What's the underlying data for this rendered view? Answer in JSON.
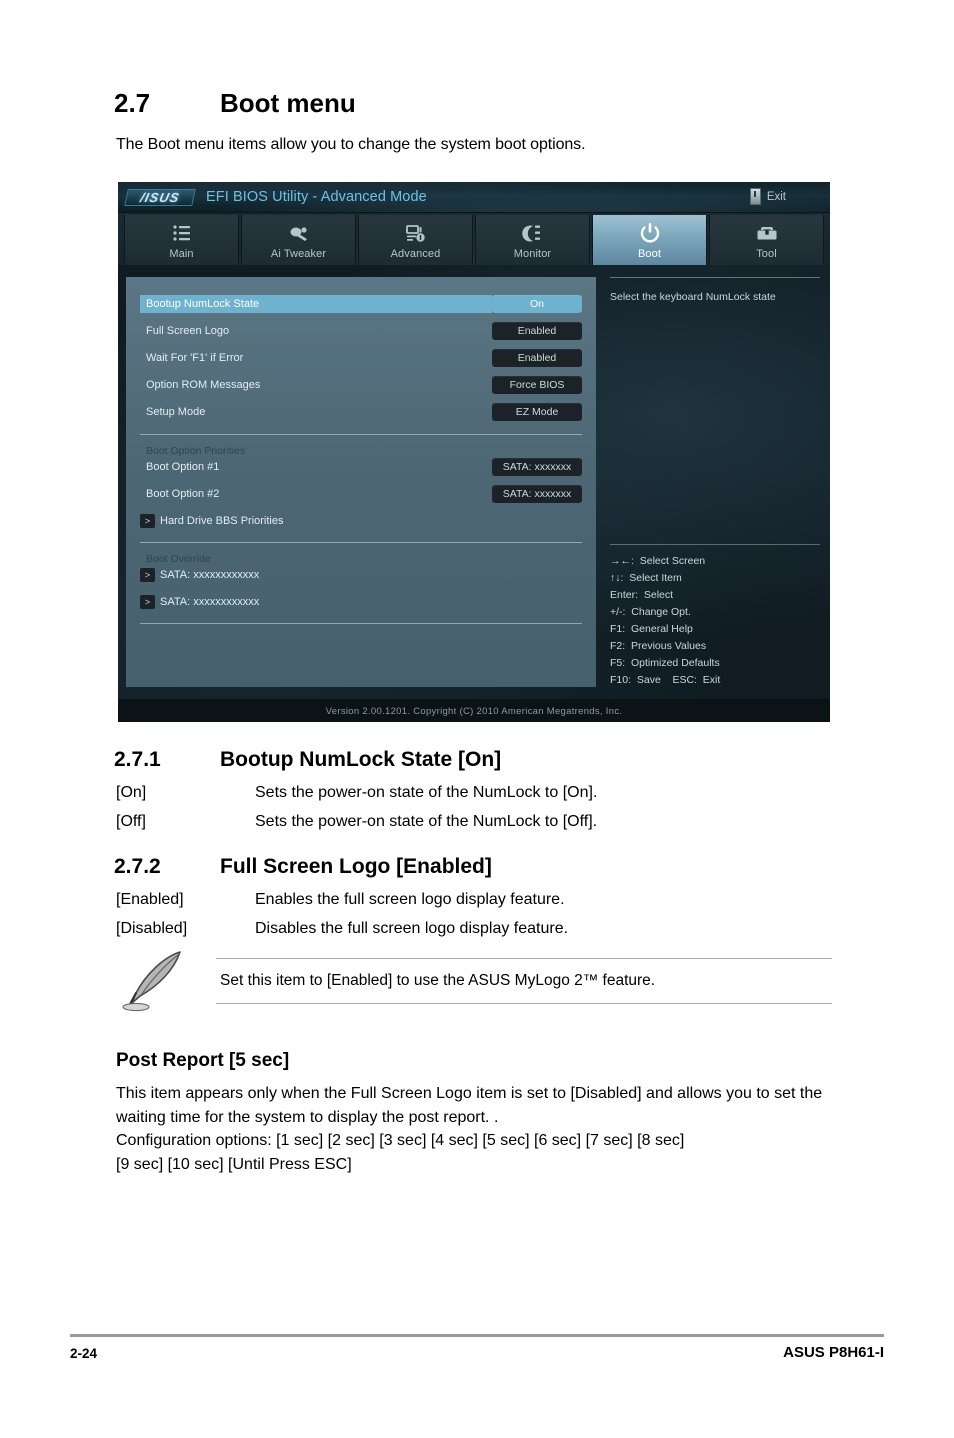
{
  "page": {
    "number_label": "2-24",
    "product_label": "ASUS P8H61-I"
  },
  "section": {
    "number": "2.7",
    "title": "Boot menu",
    "intro": "The Boot menu items allow you to change the system boot options."
  },
  "bios": {
    "titlebar": {
      "logo_text": "/ISUS",
      "title": "EFI BIOS Utility - Advanced Mode",
      "exit_label": "Exit",
      "exit_icon": "exit-door-icon"
    },
    "tabs": [
      {
        "label": "Main",
        "icon": "list-icon",
        "active": false
      },
      {
        "label": "Ai  Tweaker",
        "icon": "tuning-knob-icon",
        "active": false
      },
      {
        "label": "Advanced",
        "icon": "advanced-chip-icon",
        "active": false
      },
      {
        "label": "Monitor",
        "icon": "monitor-gauge-icon",
        "active": false
      },
      {
        "label": "Boot",
        "icon": "power-icon",
        "active": true
      },
      {
        "label": "Tool",
        "icon": "toolbox-icon",
        "active": false
      }
    ],
    "options": [
      {
        "name": "Bootup NumLock State",
        "value": "On",
        "selected": true
      },
      {
        "name": "Full Screen Logo",
        "value": "Enabled",
        "selected": false
      },
      {
        "name": "Wait For 'F1' if Error",
        "value": "Enabled",
        "selected": false
      },
      {
        "name": "Option ROM Messages",
        "value": "Force BIOS",
        "selected": false
      },
      {
        "name": "Setup Mode",
        "value": "EZ Mode",
        "selected": false
      }
    ],
    "boot_priorities": {
      "group_label": "Boot Option Priorities",
      "items": [
        {
          "name": "Boot Option #1",
          "value": "SATA: xxxxxxx"
        },
        {
          "name": "Boot Option #2",
          "value": "SATA: xxxxxxx"
        }
      ],
      "submenu": {
        "arrow": ">",
        "label": "Hard Drive BBS Priorities"
      }
    },
    "boot_override": {
      "group_label": "Boot Override",
      "items": [
        {
          "arrow": ">",
          "label": "SATA: xxxxxxxxxxxx"
        },
        {
          "arrow": ">",
          "label": "SATA: xxxxxxxxxxxx"
        }
      ]
    },
    "help": {
      "text": "Select the keyboard NumLock state"
    },
    "key_legend": [
      "→←:  Select Screen",
      "↑↓:  Select Item",
      "Enter:  Select",
      "+/-:  Change Opt.",
      "F1:  General Help",
      "F2:  Previous Values",
      "F5:  Optimized Defaults",
      "F10:  Save    ESC:  Exit"
    ],
    "footer": "Version  2.00.1201.   Copyright  (C)  2010  American  Megatrends,  Inc.",
    "colors": {
      "panel_bg": "#4d6775",
      "highlight": "#6fb2cf",
      "value_bg": "#1b2329",
      "title_text": "#6fc0e0"
    }
  },
  "sub_271": {
    "number": "2.7.1",
    "title": "Bootup NumLock State [On]",
    "rows": [
      {
        "term": "[On]",
        "desc": "Sets the power-on state of the NumLock to [On]."
      },
      {
        "term": "[Off]",
        "desc": "Sets the power-on state of the NumLock to [Off]."
      }
    ]
  },
  "sub_272": {
    "number": "2.7.2",
    "title": "Full Screen Logo [Enabled]",
    "rows": [
      {
        "term": "[Enabled]",
        "desc": "Enables the full screen logo display feature."
      },
      {
        "term": "[Disabled]",
        "desc": "Disables the full screen logo display feature."
      }
    ]
  },
  "note": {
    "icon": "feather-pen-icon",
    "text": "Set this item to [Enabled] to use the ASUS MyLogo 2™ feature."
  },
  "post_report": {
    "heading": "Post Report [5 sec]",
    "paragraph": "This item appears only when the Full Screen Logo item is set to [Disabled] and allows you to set the waiting time for the system to display the post report. .",
    "config_line1": "Configuration options: [1 sec] [2 sec] [3 sec] [4 sec] [5 sec] [6 sec] [7 sec] [8 sec]",
    "config_line2": "[9 sec] [10 sec] [Until Press ESC]"
  }
}
